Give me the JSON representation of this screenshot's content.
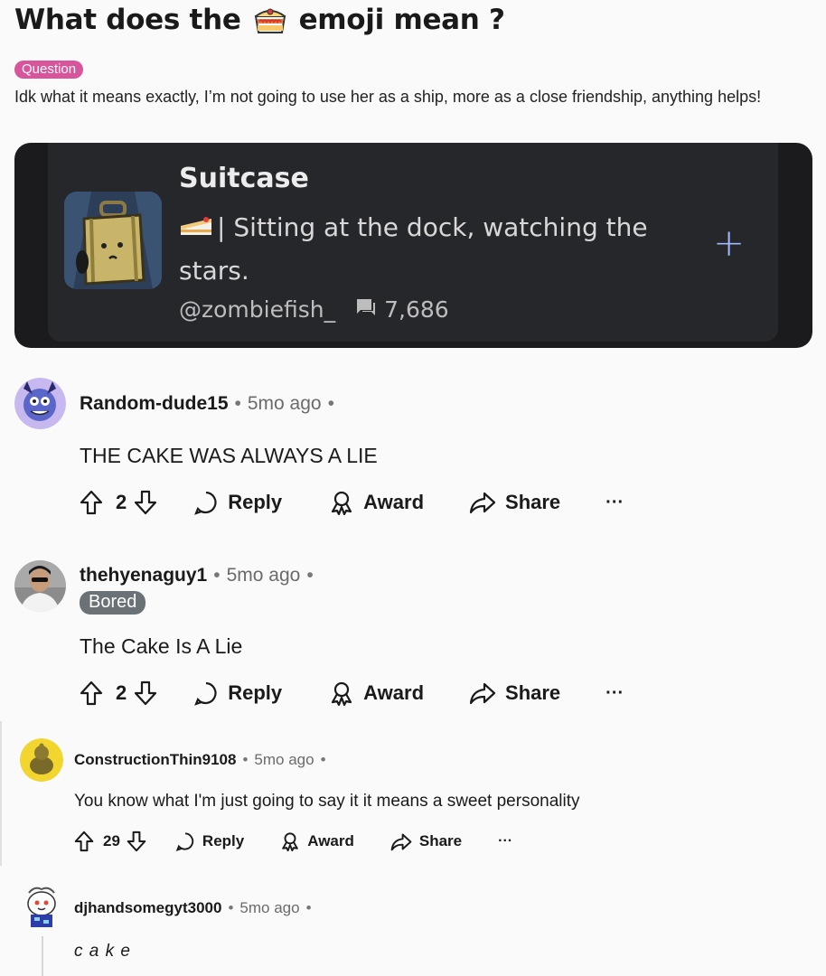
{
  "post": {
    "title_before": "What does the",
    "title_after": "emoji mean ?",
    "flair": "Question",
    "body": "Idk what it means exactly, I’m not going to use her as a ship, more as a close friendship, anything helps!"
  },
  "card": {
    "name": "Suitcase",
    "description": "| Sitting at the dock, watching the stars.",
    "handle": "@zombiefish_",
    "chat_count": "7,686",
    "plus": "+"
  },
  "comments": [
    {
      "username": "Random-dude15",
      "time": "5mo ago",
      "text": "THE CAKE WAS ALWAYS A LIE",
      "votes": "2",
      "reply": "Reply",
      "award": "Award",
      "share": "Share",
      "more": "···"
    },
    {
      "username": "thehyenaguy1",
      "time": "5mo ago",
      "flair": "Bored",
      "text": "The Cake Is A Lie",
      "votes": "2",
      "reply": "Reply",
      "award": "Award",
      "share": "Share",
      "more": "···"
    },
    {
      "username": "ConstructionThin9108",
      "time": "5mo ago",
      "text": "You know what I'm just going to say it it means a sweet personality",
      "votes": "29",
      "reply": "Reply",
      "award": "Award",
      "share": "Share",
      "more": "···"
    },
    {
      "username": "djhandsomegyt3000",
      "time": "5mo ago",
      "text": "c a k e"
    }
  ],
  "colors": {
    "question_flair": "#d9559b",
    "user_flair": "#6a7277",
    "card_background": "#26272b",
    "card_plus": "#9fb8ff"
  },
  "icons": [
    "cake-emoji-icon",
    "chat-icon",
    "plus-icon",
    "upvote-icon",
    "downvote-icon",
    "reply-icon",
    "award-icon",
    "share-icon",
    "more-icon"
  ]
}
